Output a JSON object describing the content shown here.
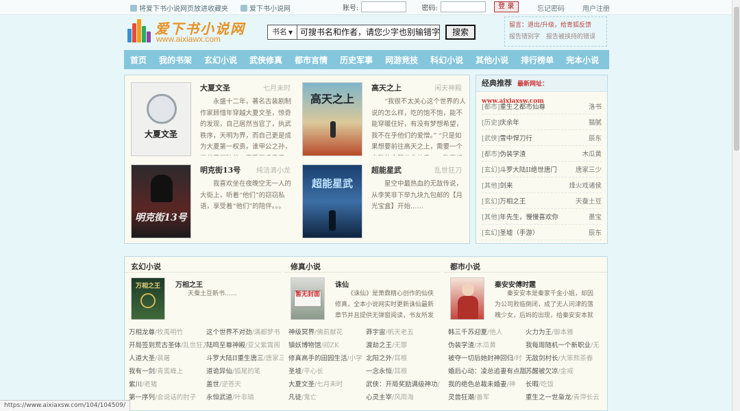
{
  "topbar": {
    "bookmark_link": "将爱下书小说网页放进收藏夹",
    "site_link": "爱下书小说网",
    "account_label": "账号:",
    "password_label": "密码:",
    "login_button": "登 录",
    "forgot_link": "忘记密码",
    "register_link": "用户注册"
  },
  "logo": {
    "title": "爱下书小说网",
    "url": "www.aixiawx.com"
  },
  "search": {
    "select_value": "书名",
    "placeholder": "可搜书名和作者，请您少字也别输错字。",
    "button": "搜索"
  },
  "notice": {
    "line1": "留言：退出/升级，给青狐反馈",
    "line2": "报告错别字　报告被挟持的错误"
  },
  "nav": [
    "首页",
    "我的书架",
    "玄幻小说",
    "武侠修真",
    "都市言情",
    "历史军事",
    "网游竞技",
    "科幻小说",
    "其他小说",
    "排行榜单",
    "完本小说"
  ],
  "featured": [
    {
      "title": "大夏文圣",
      "author": "七月未时",
      "desc": "永盛十二年，著名古装剧制作家顾惜年穿越大夏文圣，惊奇的发现，自己居然当官了，执武秩序，天明为界，而自己更是成为大夏第一权贵，谁甲公之孙，三代男丁独苗，享受万千宠爱，但让顾惜年惊",
      "cover_text": "大夏文圣"
    },
    {
      "title": "高天之上",
      "author": "闲天神殿",
      "desc": "“我很不太关心这个世界的人说的怎么样，吃的饱不饱，能不能穿暖住好，有没有梦想希望，我不在乎他们的爱憎。” “只是如果想要前往高天之上，需要一个完整的高等工业体系，一整套相关研究",
      "cover_text": "高天之上"
    },
    {
      "title": "明克街13号",
      "author": "纯洁滴小龙",
      "desc": "我喜欢坐在夜晚空无一人的大街上，听着“他们”的窃窃私语，享受着“他们”的陪伴。。。",
      "cover_text": "明克街13号"
    },
    {
      "title": "超能星武",
      "author": "乱世狂刀",
      "desc": "星空中最热血的无敌传说，从李笑非下举九块九包邮的【月光宝盒】开始……",
      "cover_text": "超能星武"
    }
  ],
  "classic": {
    "title": "经典推荐",
    "newsite": "最新网址：www.aixiaxsw.com",
    "items": [
      {
        "cat": "[都市]",
        "name": "重生之都市仙尊",
        "author": "洛书"
      },
      {
        "cat": "[历史]",
        "name": "庆余年",
        "author": "猫腻"
      },
      {
        "cat": "[武侠]",
        "name": "雪中悍刀行",
        "author": "辰东"
      },
      {
        "cat": "[都市]",
        "name": "伪装学渣",
        "author": "木瓜黄"
      },
      {
        "cat": "[玄幻]",
        "name": "斗罗大陆II绝世唐门",
        "author": "唐家三少"
      },
      {
        "cat": "[其他]",
        "name": "剑来",
        "author": "烽火戏诸侯"
      },
      {
        "cat": "[玄幻]",
        "name": "万相之王",
        "author": "天蚕土豆"
      },
      {
        "cat": "[其他]",
        "name": "年先生，慢慢喜欢你",
        "author": "墨宝"
      },
      {
        "cat": "[玄幻]",
        "name": "圣墟（手游）",
        "author": "辰东"
      }
    ]
  },
  "lower": [
    {
      "heading": "玄幻小说",
      "top_title": "万相之王",
      "top_desc": "天蚕土豆新书……",
      "cover_text": "万相之王",
      "rows": [
        [
          [
            "万相龙尊",
            "/牧禹明竹"
          ],
          [
            "这个世界不对劲",
            "/满都梦书"
          ]
        ],
        [
          [
            "开局签到荒古圣体",
            "/乱世狂刀"
          ],
          [
            "陆鸣至尊神殿",
            "/亚父紫霄阁"
          ]
        ],
        [
          [
            "人道大圣",
            "/裴屠"
          ],
          [
            "斗罗大陆II重生唐三",
            "/唐家三少"
          ]
        ],
        [
          [
            "我有一剑",
            "/青鸾峰上"
          ],
          [
            "道诡异仙",
            "/狐尾的笔"
          ]
        ],
        [
          [
            "紫川",
            "/老猪"
          ],
          [
            "盖世",
            "/逆苍天"
          ]
        ],
        [
          [
            "第一序列",
            "/会说话的肘子"
          ],
          [
            "永恒武道",
            "/叶非瑜"
          ]
        ]
      ]
    },
    {
      "heading": "修真小说",
      "top_title": "诛仙",
      "top_desc": "《诛仙》是萧鼎精心创作的仙侠修真，全本小说网实时更新诛仙最新章节并且提供无弹窗阅读，书友所发表的诛仙评论，并",
      "cover_text": "暂无封面",
      "rows": [
        [
          [
            "神级冥界",
            "/佛前献花"
          ],
          [
            "莽宇宙",
            "/帆天老五"
          ]
        ],
        [
          [
            "镇妖博物馆",
            "/阎ZK"
          ],
          [
            "渡劫之王",
            "/无罪"
          ]
        ],
        [
          [
            "修真高手的田园生活",
            "/小学"
          ],
          [
            "北阳之外",
            "/耳根"
          ]
        ],
        [
          [
            "圣墟",
            "/平心长"
          ],
          [
            "一念永恒",
            "/耳根"
          ]
        ],
        [
          [
            "大夏文圣",
            "/七月未时"
          ],
          [
            "武侠：开局奖励满级神功",
            "/"
          ]
        ],
        [
          [
            "凡徒",
            "/鬼亡"
          ],
          [
            "心灵主宰",
            "/风雨海"
          ]
        ]
      ]
    },
    {
      "heading": "都市小说",
      "top_title": "秦安安傅时霆",
      "top_desc": "秦安安本是秦家千金小姐，却因为公司败临倒闭，成了无人问津的落魄少女，后妈的出现，给秦安安本就落魄的生活雪上加",
      "cover_text": "",
      "rows": [
        [
          [
            "韩三千苏迎夏",
            "/他人"
          ],
          [
            "火力为王",
            "/御本雅"
          ]
        ],
        [
          [
            "伪装学渣",
            "/木瓜黄"
          ],
          [
            "我每周随机一个新职业",
            "/无"
          ]
        ],
        [
          [
            "被夺一切后她封神回归",
            "/时"
          ],
          [
            "无敌剑村长",
            "/大笨熊茶春"
          ]
        ],
        [
          [
            "婚后心动：凌总追妻有点甜",
            "/"
          ],
          [
            "苏醒被欠凉",
            "/金戒"
          ]
        ],
        [
          [
            "我的绝色总裁未婚妻",
            "/神"
          ],
          [
            "长暇",
            "/吃饭"
          ]
        ],
        [
          [
            "灵兽狂潮",
            "/善军"
          ],
          [
            "重生之一世枭龙",
            "/青萍长云"
          ]
        ]
      ]
    }
  ],
  "status_url": "https://www.aixiaxsw.com/104/104509/",
  "colors": {
    "nav": "#84c6dc",
    "accent": "#e79124",
    "panel": "#fbfaf0"
  }
}
